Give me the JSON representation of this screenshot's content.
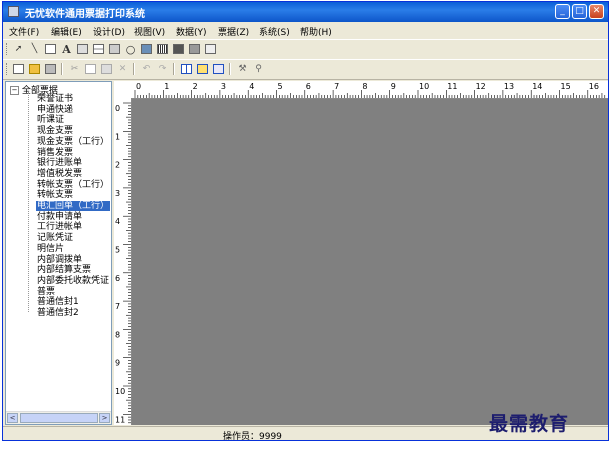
{
  "window": {
    "title": "无忧软件通用票据打印系统"
  },
  "menu": [
    {
      "label": "文件(F)"
    },
    {
      "label": "编辑(E)"
    },
    {
      "label": "设计(D)"
    },
    {
      "label": "视图(V)"
    },
    {
      "label": "数据(Y)"
    },
    {
      "label": "票据(Z)"
    },
    {
      "label": "系统(S)"
    },
    {
      "label": "帮助(H)"
    }
  ],
  "toolbar1_icons": [
    "pointer-icon",
    "line-icon",
    "rectangle-icon",
    "text-icon",
    "image-icon",
    "table-icon",
    "frame-icon",
    "circle-icon",
    "picture-icon",
    "barcode-icon",
    "field-icon",
    "chart-icon",
    "edit-icon"
  ],
  "toolbar2_icons": [
    "new-icon",
    "open-icon",
    "save-icon",
    "cut-icon",
    "copy-icon",
    "paste-icon",
    "delete-icon",
    "undo-icon",
    "redo-icon",
    "grid-icon",
    "preview-icon",
    "print-icon",
    "tool-icon",
    "search-icon"
  ],
  "tree": {
    "root": "全部票据",
    "items": [
      {
        "label": "荣誉证书"
      },
      {
        "label": "申通快递"
      },
      {
        "label": "听课证"
      },
      {
        "label": "现金支票"
      },
      {
        "label": "现金支票（工行）"
      },
      {
        "label": "销售发票"
      },
      {
        "label": "银行进账单"
      },
      {
        "label": "增值税发票"
      },
      {
        "label": "转帐支票（工行）"
      },
      {
        "label": "转帐支票"
      },
      {
        "label": "电汇回单（工行）",
        "selected": true
      },
      {
        "label": "付款申请单"
      },
      {
        "label": "工行进帐单"
      },
      {
        "label": "记账凭证"
      },
      {
        "label": "明信片"
      },
      {
        "label": "内部调拨单"
      },
      {
        "label": "内部结算支票"
      },
      {
        "label": "内部委托收款凭证"
      },
      {
        "label": "普票"
      },
      {
        "label": "普通信封1"
      },
      {
        "label": "普通信封2"
      }
    ]
  },
  "ruler": {
    "top": [
      "0",
      "1",
      "2",
      "3",
      "4",
      "5",
      "6",
      "7",
      "8",
      "9",
      "10",
      "11",
      "12",
      "13",
      "14",
      "15",
      "16"
    ],
    "left": [
      "0",
      "1",
      "2",
      "3",
      "4",
      "5",
      "6",
      "7",
      "8",
      "9",
      "10",
      "11"
    ]
  },
  "status": {
    "operator": "操作员：9999"
  },
  "watermark": "最需教育"
}
